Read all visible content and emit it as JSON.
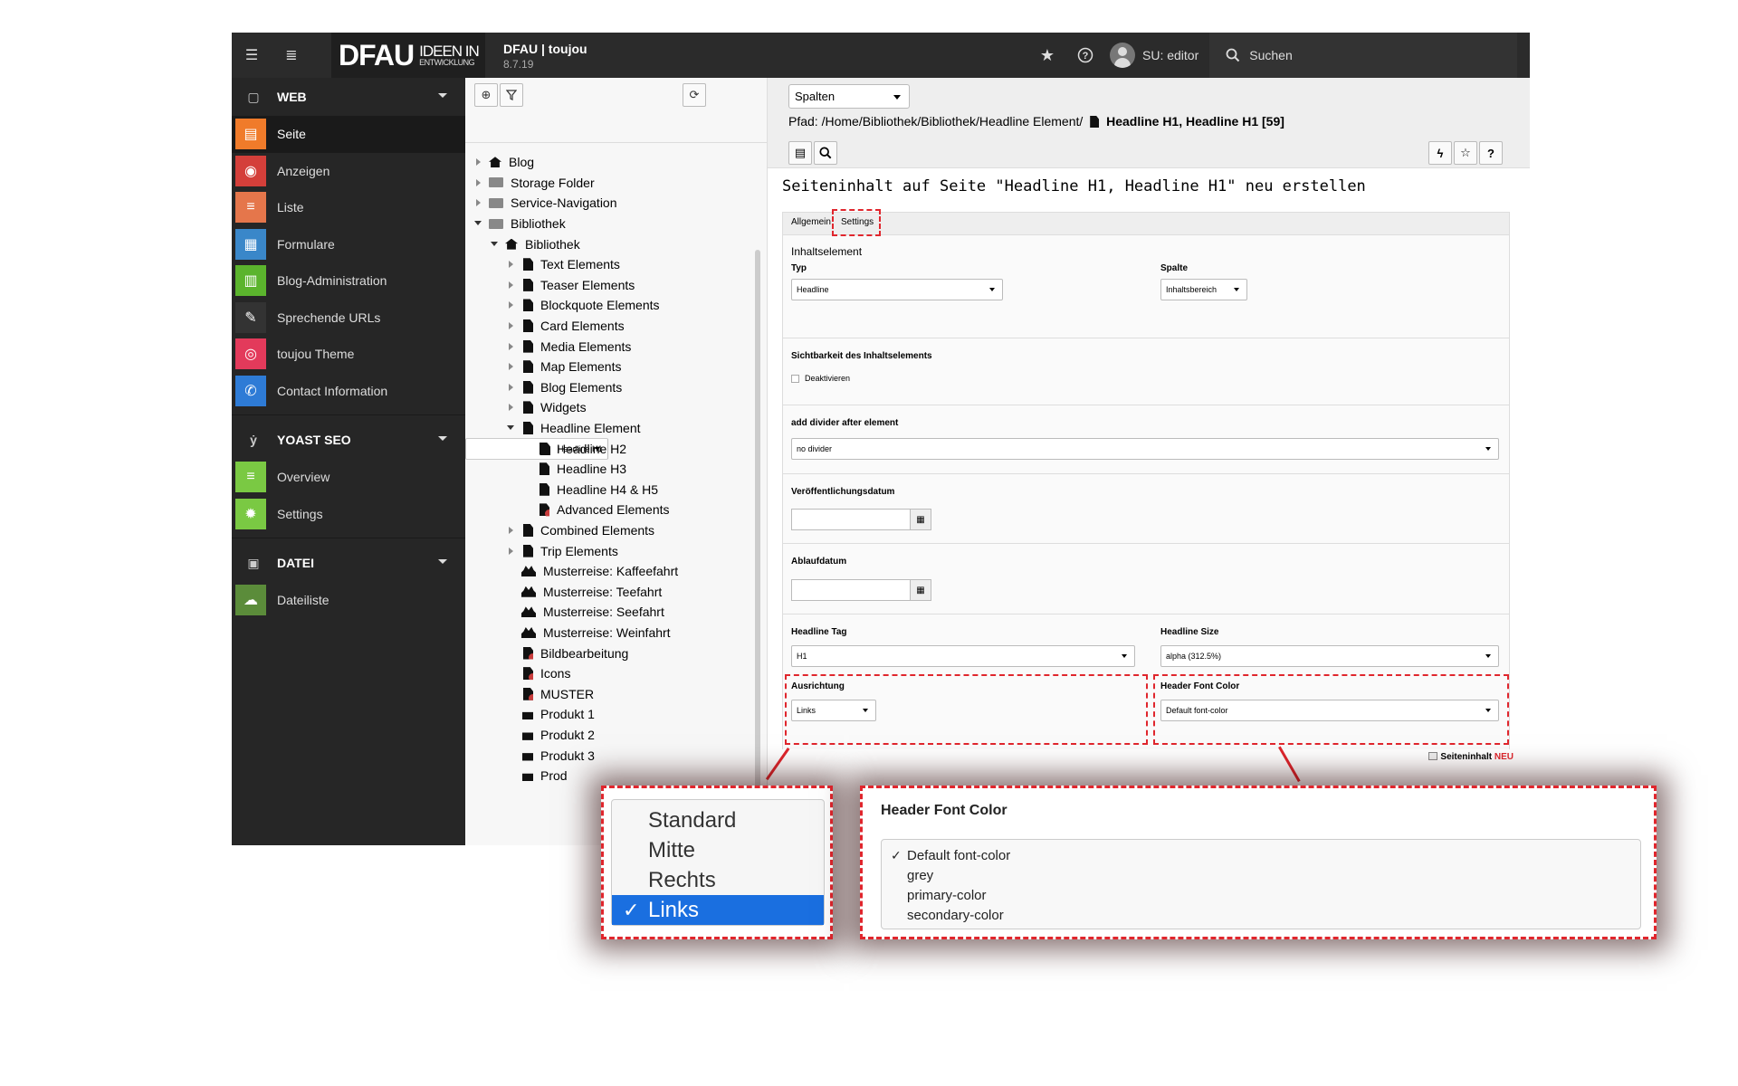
{
  "topbar": {
    "logo_main": "DFAU",
    "logo_line1": "IDEEN IN",
    "logo_line2": "ENTWICKLUNG",
    "site_name": "DFAU | toujou",
    "version": "8.7.19",
    "user": "SU: editor",
    "search_label": "Suchen"
  },
  "modules": {
    "web": {
      "label": "WEB",
      "items": [
        {
          "label": "Seite",
          "color": "#f07b2a",
          "icon": "page-icon"
        },
        {
          "label": "Anzeigen",
          "color": "#d43f3a",
          "icon": "eye-icon"
        },
        {
          "label": "Liste",
          "color": "#e5764b",
          "icon": "list-icon"
        },
        {
          "label": "Formulare",
          "color": "#3a87c9",
          "icon": "form-icon"
        },
        {
          "label": "Blog-Administration",
          "color": "#5bb42d",
          "icon": "blog-icon"
        },
        {
          "label": "Sprechende URLs",
          "color": "#333333",
          "icon": "pen-icon"
        },
        {
          "label": "toujou Theme",
          "color": "#e33a5b",
          "icon": "fingerprint-icon"
        },
        {
          "label": "Contact Information",
          "color": "#2e7bd6",
          "icon": "contact-icon"
        }
      ]
    },
    "yoast": {
      "label": "YOAST SEO",
      "items": [
        {
          "label": "Overview",
          "color": "#7ac943",
          "icon": "overview-icon"
        },
        {
          "label": "Settings",
          "color": "#7ac943",
          "icon": "gear-icon"
        }
      ]
    },
    "datei": {
      "label": "DATEI",
      "items": [
        {
          "label": "Dateiliste",
          "color": "#5b8c3a",
          "icon": "cloud-icon"
        }
      ]
    }
  },
  "tree": {
    "rows": [
      {
        "label": "Blog",
        "depth": 2,
        "toggle": "c",
        "icon": "home"
      },
      {
        "label": "Storage Folder",
        "depth": 2,
        "toggle": "c",
        "icon": "folder"
      },
      {
        "label": "Service-Navigation",
        "depth": 2,
        "toggle": "c",
        "icon": "folder"
      },
      {
        "label": "Bibliothek",
        "depth": 2,
        "toggle": "o",
        "icon": "folder"
      },
      {
        "label": "Bibliothek",
        "depth": 3,
        "toggle": "o",
        "icon": "home"
      },
      {
        "label": "Text Elements",
        "depth": 4,
        "toggle": "c",
        "icon": "page"
      },
      {
        "label": "Teaser Elements",
        "depth": 4,
        "toggle": "c",
        "icon": "page"
      },
      {
        "label": "Blockquote Elements",
        "depth": 4,
        "toggle": "c",
        "icon": "page"
      },
      {
        "label": "Card Elements",
        "depth": 4,
        "toggle": "c",
        "icon": "page"
      },
      {
        "label": "Media Elements",
        "depth": 4,
        "toggle": "c",
        "icon": "page"
      },
      {
        "label": "Map Elements",
        "depth": 4,
        "toggle": "c",
        "icon": "page"
      },
      {
        "label": "Blog Elements",
        "depth": 4,
        "toggle": "c",
        "icon": "page"
      },
      {
        "label": "Widgets",
        "depth": 4,
        "toggle": "c",
        "icon": "page"
      },
      {
        "label": "Headline Element",
        "depth": 4,
        "toggle": "o",
        "icon": "page"
      },
      {
        "label": "Headline H1",
        "depth": 5,
        "toggle": "",
        "icon": "page",
        "selected": true
      },
      {
        "label": "Headline H2",
        "depth": 5,
        "toggle": "",
        "icon": "page"
      },
      {
        "label": "Headline H3",
        "depth": 5,
        "toggle": "",
        "icon": "page"
      },
      {
        "label": "Headline H4 & H5",
        "depth": 5,
        "toggle": "",
        "icon": "page"
      },
      {
        "label": "Advanced Elements",
        "depth": 5,
        "toggle": "",
        "icon": "restricted"
      },
      {
        "label": "Combined Elements",
        "depth": 4,
        "toggle": "c",
        "icon": "page"
      },
      {
        "label": "Trip Elements",
        "depth": 4,
        "toggle": "c",
        "icon": "page"
      },
      {
        "label": "Musterreise: Kaffeefahrt",
        "depth": 4,
        "toggle": "",
        "icon": "group"
      },
      {
        "label": "Musterreise: Teefahrt",
        "depth": 4,
        "toggle": "",
        "icon": "group"
      },
      {
        "label": "Musterreise: Seefahrt",
        "depth": 4,
        "toggle": "",
        "icon": "group"
      },
      {
        "label": "Musterreise: Weinfahrt",
        "depth": 4,
        "toggle": "",
        "icon": "group"
      },
      {
        "label": "Bildbearbeitung",
        "depth": 4,
        "toggle": "",
        "icon": "restricted"
      },
      {
        "label": "Icons",
        "depth": 4,
        "toggle": "",
        "icon": "restricted"
      },
      {
        "label": "MUSTER",
        "depth": 4,
        "toggle": "",
        "icon": "restricted"
      },
      {
        "label": "Produkt 1",
        "depth": 4,
        "toggle": "",
        "icon": "gift"
      },
      {
        "label": "Produkt 2",
        "depth": 4,
        "toggle": "",
        "icon": "gift"
      },
      {
        "label": "Produkt 3",
        "depth": 4,
        "toggle": "",
        "icon": "gift"
      },
      {
        "label": "Prod",
        "depth": 4,
        "toggle": "",
        "icon": "gift"
      }
    ]
  },
  "doc": {
    "column_select": "Spalten",
    "path_prefix": "Pfad: /Home/Bibliothek/Bibliothek/Headline Element/",
    "path_page": "Headline H1, Headline H1 [59]",
    "title": "Seiteninhalt auf Seite \"Headline H1, Headline H1\" neu erstellen",
    "tabs": [
      "Allgemein",
      "Settings"
    ],
    "active_tab": "Settings",
    "section_title": "Inhaltselement",
    "typ_label": "Typ",
    "typ_value": "Headline",
    "spalte_label": "Spalte",
    "spalte_value": "Inhaltsbereich",
    "visibility_label": "Sichtbarkeit des Inhaltselements",
    "visibility_checkbox": "Deaktivieren",
    "divider_label": "add divider after element",
    "divider_value": "no divider",
    "pub_label": "Veröffentlichungsdatum",
    "exp_label": "Ablaufdatum",
    "headline_tag_label": "Headline Tag",
    "headline_tag_value": "H1",
    "headline_size_label": "Headline Size",
    "headline_size_value": "alpha (312.5%)",
    "ausrichtung_label": "Ausrichtung",
    "ausrichtung_value": "Links",
    "font_color_label": "Header Font Color",
    "font_color_value": "Default font-color",
    "new_tag_prefix": "Seiteninhalt",
    "new_tag_suffix": "NEU"
  },
  "callout_align": {
    "options": [
      "Standard",
      "Mitte",
      "Rechts",
      "Links"
    ],
    "selected": "Links"
  },
  "callout_color": {
    "title": "Header Font Color",
    "options": [
      "Default font-color",
      "grey",
      "primary-color",
      "secondary-color"
    ],
    "selected": "Default font-color"
  }
}
